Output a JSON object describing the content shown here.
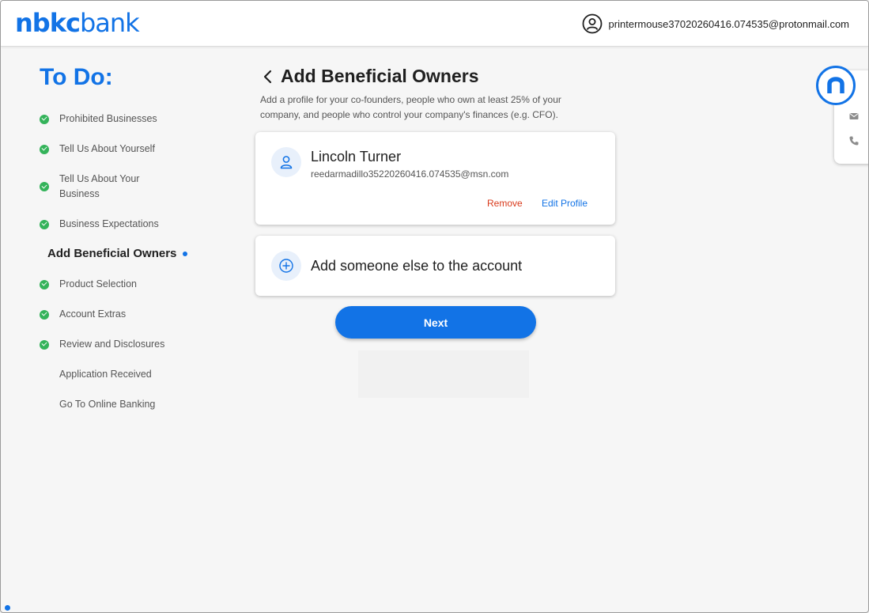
{
  "header": {
    "logo_bold": "nbkc",
    "logo_light": "bank",
    "user_email": "printermouse37020260416.074535@protonmail.com",
    "user_icon": "user-circle-icon"
  },
  "sidebar": {
    "title": "To Do:",
    "steps": [
      {
        "label": "Prohibited Businesses",
        "status": "complete"
      },
      {
        "label": "Tell Us About Yourself",
        "status": "complete"
      },
      {
        "label": "Tell Us About Your Business",
        "status": "complete"
      },
      {
        "label": "Business Expectations",
        "status": "complete"
      },
      {
        "label": "Add Beneficial Owners",
        "status": "current"
      },
      {
        "label": "Product Selection",
        "status": "complete"
      },
      {
        "label": "Account Extras",
        "status": "complete"
      },
      {
        "label": "Review and Disclosures",
        "status": "complete"
      },
      {
        "label": "Application Received",
        "status": "pending"
      },
      {
        "label": "Go To Online Banking",
        "status": "pending"
      }
    ]
  },
  "main": {
    "title": "Add Beneficial Owners",
    "subtitle": "Add a profile for your co-founders, people who own at least 25% of your company, and people who control your company's finances (e.g. CFO).",
    "owner": {
      "name": "Lincoln Turner",
      "email": "reedarmadillo35220260416.074535@msn.com",
      "remove_label": "Remove",
      "edit_label": "Edit Profile"
    },
    "add_label": "Add someone else to the account",
    "next_label": "Next"
  },
  "widget": {
    "badge_letter": "n",
    "icons": [
      "mail-icon",
      "phone-icon"
    ]
  },
  "colors": {
    "brand": "#1273e6",
    "complete": "#34b35a",
    "remove": "#d93a1b"
  }
}
